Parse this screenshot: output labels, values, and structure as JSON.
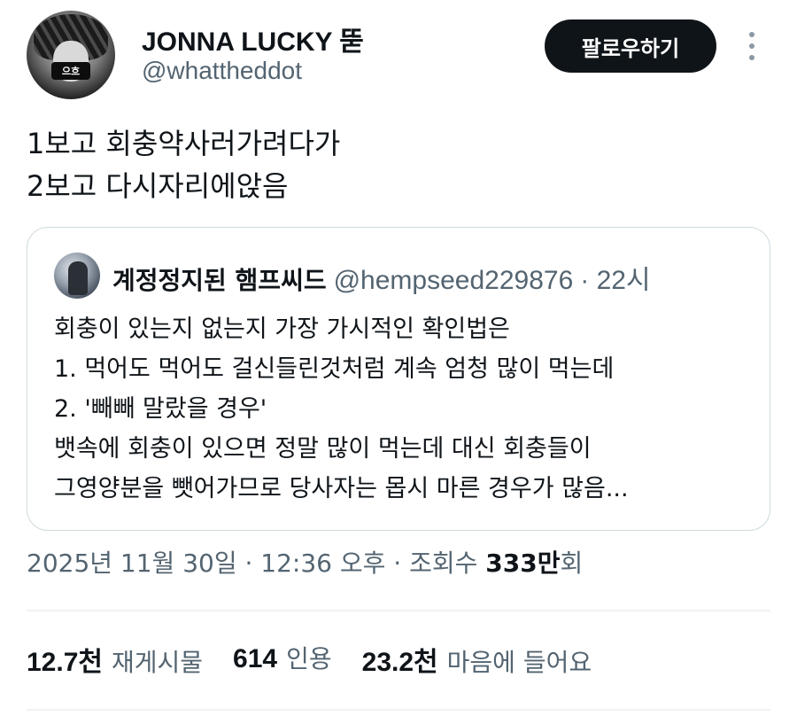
{
  "author": {
    "display_name": "JONNA LUCKY 뚣",
    "handle": "@whattheddot",
    "avatar_label": "으흐"
  },
  "actions": {
    "follow_label": "팔로우하기",
    "more_icon": "more-vertical-icon"
  },
  "tweet": {
    "lines": [
      "1보고 회충약사러가려다가",
      "2보고 다시자리에앉음"
    ]
  },
  "quoted_tweet": {
    "display_name": "계정정지된 햄프씨드",
    "handle": "@hempseed229876",
    "time": "· 22시",
    "lines": [
      "회충이 있는지 없는지 가장 가시적인 확인법은",
      "1. 먹어도 먹어도 걸신들린것처럼 계속 엄청 많이 먹는데",
      "2. '빼빼 말랐을 경우'",
      "뱃속에 회충이 있으면 정말 많이 먹는데 대신 회충들이",
      "그영양분을 뺏어가므로 당사자는 몹시 마른 경우가 많음..."
    ]
  },
  "meta": {
    "timestamp": "2025년 11월 30일 · 12:36 오후 · 조회수 ",
    "views_number": "333만",
    "views_suffix": "회"
  },
  "stats": {
    "reposts_count": "12.7천",
    "reposts_label": "재게시물",
    "quotes_count": "614",
    "quotes_label": "인용",
    "likes_count": "23.2천",
    "likes_label": "마음에 들어요"
  },
  "colors": {
    "text_primary": "#0f1419",
    "text_secondary": "#536471",
    "border": "#cfd9de",
    "button_bg": "#0f1419"
  }
}
